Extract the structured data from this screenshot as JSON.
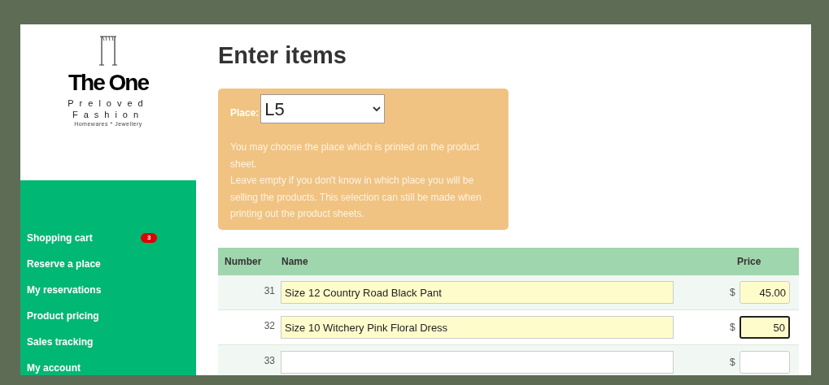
{
  "logo": {
    "name": "The One",
    "tagline_1": "Preloved",
    "tagline_2": "Fashion",
    "tagline_3": "Homewares * Jewellery"
  },
  "sidebar": {
    "items": [
      {
        "label": "Shopping cart",
        "badge": "3"
      },
      {
        "label": "Reserve a place"
      },
      {
        "label": "My reservations"
      },
      {
        "label": "Product pricing"
      },
      {
        "label": "Sales tracking"
      },
      {
        "label": "My account"
      }
    ]
  },
  "page": {
    "title": "Enter items"
  },
  "place_panel": {
    "label": "Place:",
    "value": "L5",
    "help": [
      "You may choose the place which is printed on the product sheet.",
      "Leave empty if you don't know in which place you will be selling the products. This selection can still be made when printing out the product sheets."
    ]
  },
  "table": {
    "columns": [
      "Number",
      "Name",
      "Price"
    ],
    "rows": [
      {
        "number": "31",
        "name": "Size 12 Country Road Black Pant",
        "currency": "$",
        "price": "45.00",
        "focused": false
      },
      {
        "number": "32",
        "name": "Size 10 Witchery Pink Floral Dress",
        "currency": "$",
        "price": "50",
        "focused": true
      },
      {
        "number": "33",
        "name": "",
        "currency": "$",
        "price": "",
        "focused": false
      }
    ]
  }
}
